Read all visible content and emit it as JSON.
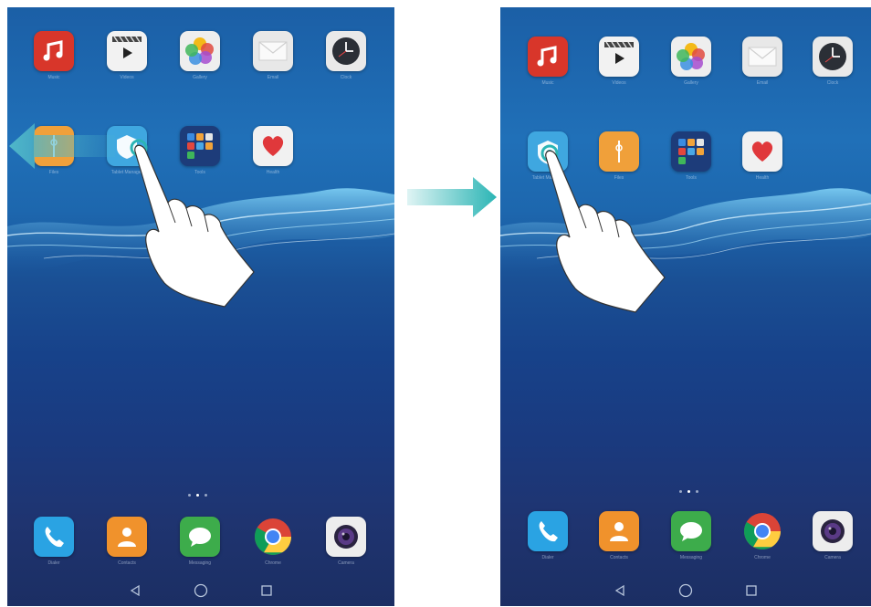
{
  "left_screen": {
    "apps_row1": [
      {
        "label": "Music",
        "icon": "music-icon",
        "color": "#d8362a"
      },
      {
        "label": "Videos",
        "icon": "video-icon",
        "color": "#f2f2f2"
      },
      {
        "label": "Gallery",
        "icon": "gallery-icon",
        "color": "#eeeeee"
      },
      {
        "label": "Email",
        "icon": "email-icon",
        "color": "#e8e8e8"
      },
      {
        "label": "Clock",
        "icon": "clock-icon",
        "color": "#e9e9e9"
      }
    ],
    "apps_row2": [
      {
        "label": "Files",
        "icon": "files-icon",
        "color": "#f0a03a"
      },
      {
        "label": "Tablet Manager",
        "icon": "tablet-manager-icon",
        "color": "#3fa7e0"
      },
      {
        "label": "Tools",
        "icon": "tools-folder-icon",
        "color": "#1d3c7a"
      },
      {
        "label": "Health",
        "icon": "health-icon",
        "color": "#f1f1f1"
      }
    ],
    "dock": [
      {
        "label": "Dialer",
        "icon": "phone-icon",
        "color": "#2aa3e3"
      },
      {
        "label": "Contacts",
        "icon": "contacts-icon",
        "color": "#f0922c"
      },
      {
        "label": "Messaging",
        "icon": "messaging-icon",
        "color": "#3dac4b"
      },
      {
        "label": "Chrome",
        "icon": "chrome-icon",
        "color": "#ffffff"
      },
      {
        "label": "Camera",
        "icon": "camera-icon",
        "color": "#ededed"
      }
    ]
  },
  "right_screen": {
    "apps_row1": [
      {
        "label": "Music",
        "icon": "music-icon",
        "color": "#d8362a"
      },
      {
        "label": "Videos",
        "icon": "video-icon",
        "color": "#f2f2f2"
      },
      {
        "label": "Gallery",
        "icon": "gallery-icon",
        "color": "#eeeeee"
      },
      {
        "label": "Email",
        "icon": "email-icon",
        "color": "#e8e8e8"
      },
      {
        "label": "Clock",
        "icon": "clock-icon",
        "color": "#e9e9e9"
      }
    ],
    "apps_row2": [
      {
        "label": "Tablet Manager",
        "icon": "tablet-manager-icon",
        "color": "#3fa7e0"
      },
      {
        "label": "Files",
        "icon": "files-icon",
        "color": "#f0a03a"
      },
      {
        "label": "Tools",
        "icon": "tools-folder-icon",
        "color": "#1d3c7a"
      },
      {
        "label": "Health",
        "icon": "health-icon",
        "color": "#f1f1f1"
      }
    ],
    "dock": [
      {
        "label": "Dialer",
        "icon": "phone-icon",
        "color": "#2aa3e3"
      },
      {
        "label": "Contacts",
        "icon": "contacts-icon",
        "color": "#f0922c"
      },
      {
        "label": "Messaging",
        "icon": "messaging-icon",
        "color": "#3dac4b"
      },
      {
        "label": "Chrome",
        "icon": "chrome-icon",
        "color": "#ffffff"
      },
      {
        "label": "Camera",
        "icon": "camera-icon",
        "color": "#ededed"
      }
    ]
  },
  "colors": {
    "arrow": "#2bb5b5",
    "drag_arrow": "#5ab6d8"
  },
  "nav": [
    "back-icon",
    "home-icon",
    "recents-icon"
  ]
}
